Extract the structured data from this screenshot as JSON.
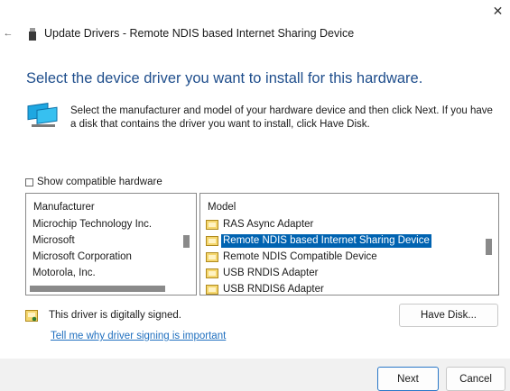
{
  "window": {
    "close_glyph": "✕",
    "back_glyph": "←",
    "title": "Update Drivers - Remote NDIS based Internet Sharing Device"
  },
  "heading": "Select the device driver you want to install for this hardware.",
  "description": "Select the manufacturer and model of your hardware device and then click Next. If you have a disk that contains the driver you want to install, click Have Disk.",
  "compatible": {
    "label": "Show compatible hardware",
    "checked": false
  },
  "manufacturer": {
    "header": "Manufacturer",
    "items": [
      "Microchip Technology Inc.",
      "Microsoft",
      "Microsoft Corporation",
      "Motorola, Inc."
    ],
    "selected": "Microsoft"
  },
  "model": {
    "header": "Model",
    "items": [
      "RAS Async Adapter",
      "Remote NDIS based Internet Sharing Device",
      "Remote NDIS Compatible Device",
      "USB RNDIS Adapter",
      "USB RNDIS6 Adapter"
    ],
    "selected": "Remote NDIS based Internet Sharing Device"
  },
  "signed_text": "This driver is digitally signed.",
  "signing_link": "Tell me why driver signing is important",
  "buttons": {
    "have_disk": "Have Disk...",
    "next": "Next",
    "cancel": "Cancel"
  },
  "colors": {
    "heading": "#1f4e8c",
    "selection": "#0063b1",
    "link": "#1f6fbf"
  }
}
